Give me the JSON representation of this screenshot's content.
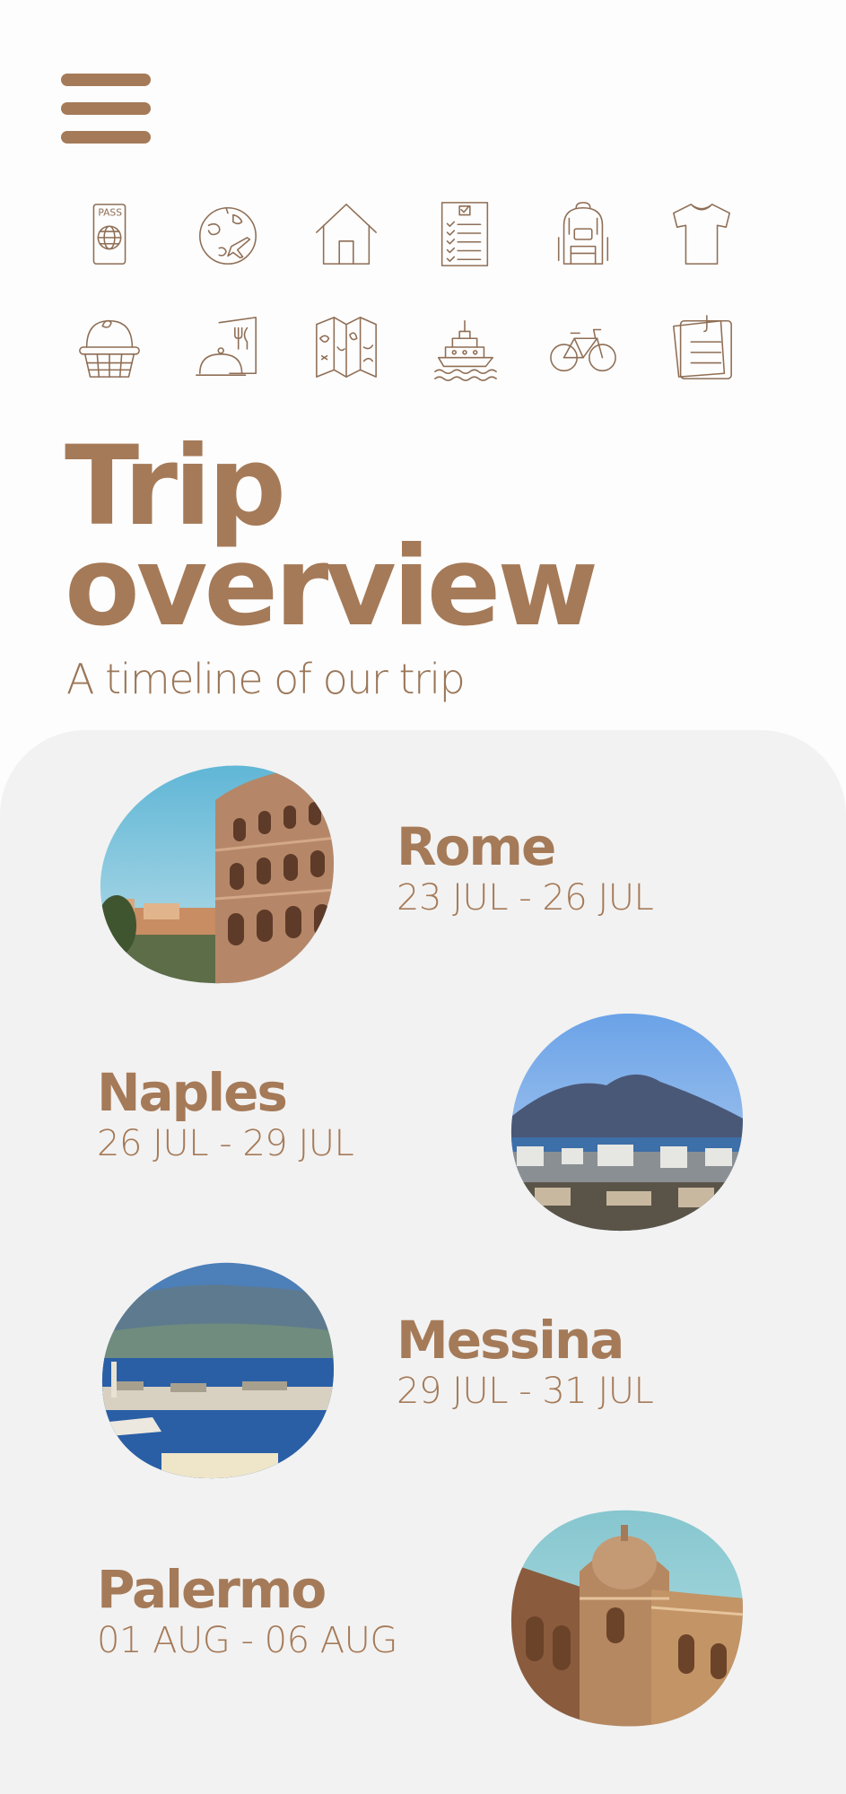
{
  "header": {
    "menu_icon": "hamburger-menu-icon",
    "icons_row1": [
      "passport-icon",
      "globe-plane-icon",
      "house-icon",
      "checklist-icon",
      "backpack-icon",
      "tshirt-icon"
    ],
    "icons_row2": [
      "basket-icon",
      "restaurant-menu-icon",
      "map-icon",
      "ship-icon",
      "bicycle-icon",
      "notes-icon"
    ],
    "passport_text": "PASS"
  },
  "page": {
    "title_line1": "Trip",
    "title_line2": "overview",
    "subtitle": "A timeline of our trip"
  },
  "timeline": {
    "stops": [
      {
        "name": "Rome",
        "dates": "23 JUL - 26 JUL"
      },
      {
        "name": "Naples",
        "dates": "26 JUL - 29 JUL"
      },
      {
        "name": "Messina",
        "dates": "29 JUL - 31 JUL"
      },
      {
        "name": "Palermo",
        "dates": "01 AUG - 06 AUG"
      }
    ]
  },
  "colors": {
    "accent": "#a57a58",
    "background": "#fdfdfd",
    "panel": "#f2f2f2"
  }
}
